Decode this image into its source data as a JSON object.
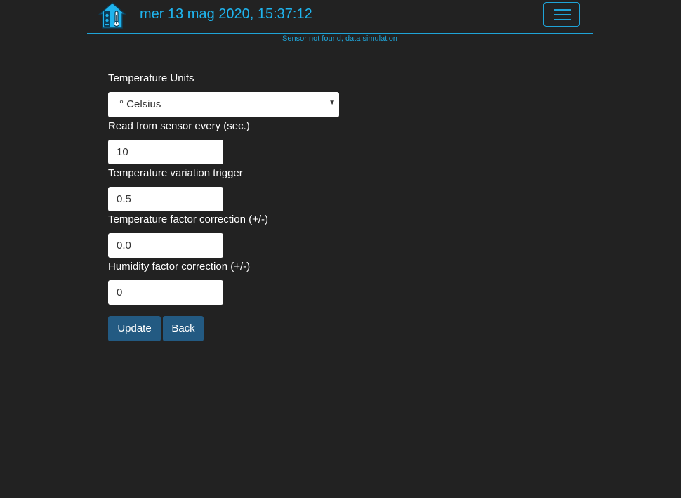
{
  "header": {
    "datetime": "mer 13 mag 2020, 15:37:12",
    "logo_icon": "house-thermometer-icon",
    "menu_icon": "hamburger-menu-icon"
  },
  "status_message": "Sensor not found, data simulation",
  "form": {
    "temperature_units": {
      "label": "Temperature Units",
      "value": "° Celsius"
    },
    "read_interval": {
      "label": "Read from sensor every (sec.)",
      "value": "10"
    },
    "variation_trigger": {
      "label": "Temperature variation trigger",
      "value": "0.5"
    },
    "temp_correction": {
      "label": "Temperature factor correction (+/-)",
      "value": "0.0"
    },
    "humidity_correction": {
      "label": "Humidity factor correction (+/-)",
      "value": "0"
    }
  },
  "buttons": {
    "update_label": "Update",
    "back_label": "Back"
  },
  "colors": {
    "background": "#222222",
    "accent": "#1fb4ee",
    "button": "#235a82"
  }
}
